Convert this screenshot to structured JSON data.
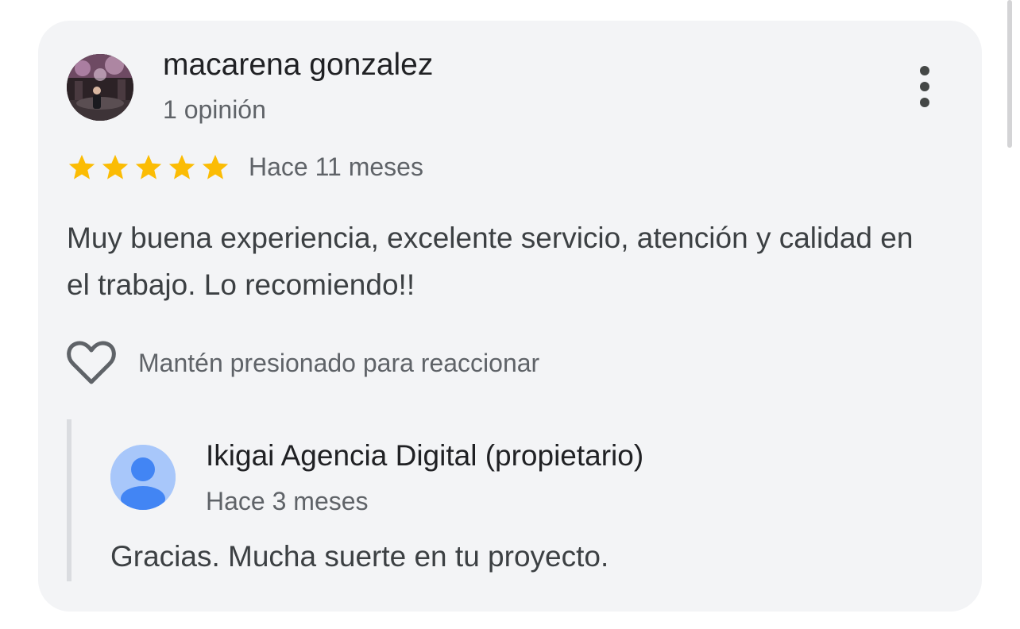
{
  "review": {
    "author_name": "macarena gonzalez",
    "author_meta": "1 opinión",
    "rating": 5,
    "rating_max": 5,
    "time": "Hace 11 meses",
    "text": "Muy buena experiencia, excelente servicio, atención y calidad en el trabajo. Lo recomiendo!!",
    "react_label": "Mantén presionado para reaccionar",
    "more_icon": "more-vert-icon",
    "react_icon": "heart-outline-icon",
    "star_color": "#fbbc04"
  },
  "owner_reply": {
    "name": "Ikigai Agencia Digital (propietario)",
    "time": "Hace 3 meses",
    "text": "Gracias. Mucha suerte en tu proyecto.",
    "avatar_icon": "default-person-avatar-icon",
    "avatar_bg": "#a8c7fa",
    "avatar_fg": "#4285f4"
  }
}
